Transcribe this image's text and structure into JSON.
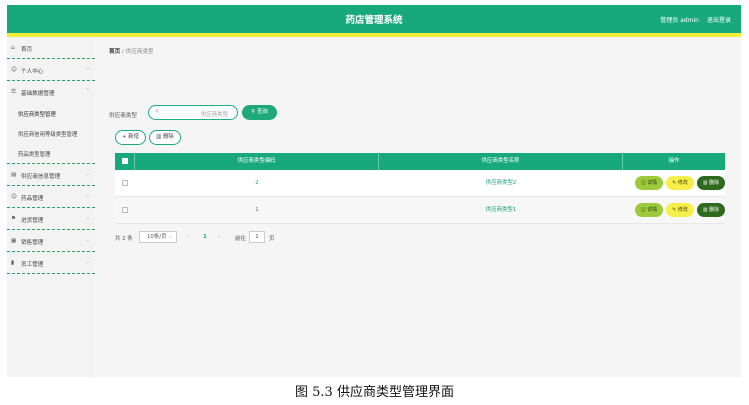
{
  "header": {
    "title": "药店管理系统",
    "user": "管理员 admin",
    "logout": "退出登录"
  },
  "sidebar": {
    "items": [
      {
        "icon": "⌂",
        "label": "首页"
      },
      {
        "icon": "☺",
        "label": "个人中心"
      },
      {
        "icon": "☰",
        "label": "基础数据管理"
      },
      {
        "icon": "▤",
        "label": "供应商信息管理"
      },
      {
        "icon": "☺",
        "label": "药品管理"
      },
      {
        "icon": "⚑",
        "label": "进货管理"
      },
      {
        "icon": "▦",
        "label": "销售管理"
      },
      {
        "icon": "▮",
        "label": "员工管理"
      }
    ],
    "sub_items": [
      "供应商类型管理",
      "供应商信用等级类型管理",
      "药品类型管理"
    ],
    "chevron": "⌄"
  },
  "breadcrumb": {
    "home": "首页",
    "sep": "/",
    "current": "供应商类型"
  },
  "search": {
    "label": "供应商类型",
    "placeholder": "供应商类型",
    "button": "查询"
  },
  "actions": {
    "add": "+ 新增",
    "delete": "删除"
  },
  "table": {
    "headers": [
      "供应商类型编码",
      "供应商类型名称",
      "操作"
    ],
    "rows": [
      {
        "code": "2",
        "name": "供应商类型2"
      },
      {
        "code": "1",
        "name": "供应商类型1"
      }
    ],
    "ops": {
      "detail": "详情",
      "edit": "修改",
      "delete": "删除"
    }
  },
  "pagination": {
    "total": "共 2 条",
    "page_size": "10条/页",
    "current": "1",
    "goto": "前往",
    "goto_value": "1",
    "page_unit": "页"
  },
  "caption": "图 5.3 供应商类型管理界面",
  "colors": {
    "primary": "#18a97b",
    "accent_stripe": "#f2ef3a",
    "detail": "#9ecb3c",
    "edit": "#f6ee4a",
    "delete": "#2d6a1d"
  }
}
